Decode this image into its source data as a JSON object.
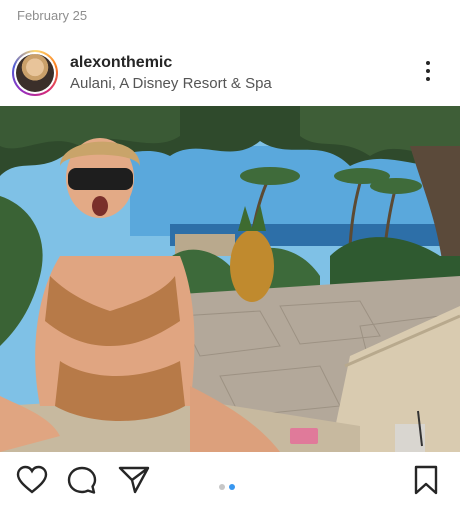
{
  "post": {
    "date": "February 25",
    "username": "alexonthemic",
    "location": "Aulani, A Disney Resort & Spa"
  },
  "icons": {
    "more": "more-options-icon",
    "like": "heart-icon",
    "comment": "comment-icon",
    "share": "send-icon",
    "save": "bookmark-icon"
  },
  "carousel": {
    "total": 2,
    "active": 2
  },
  "colors": {
    "active_dot": "#3897f0",
    "inactive_dot": "#c7c7c7",
    "text_primary": "#262626",
    "text_secondary": "#8e8e8e"
  }
}
